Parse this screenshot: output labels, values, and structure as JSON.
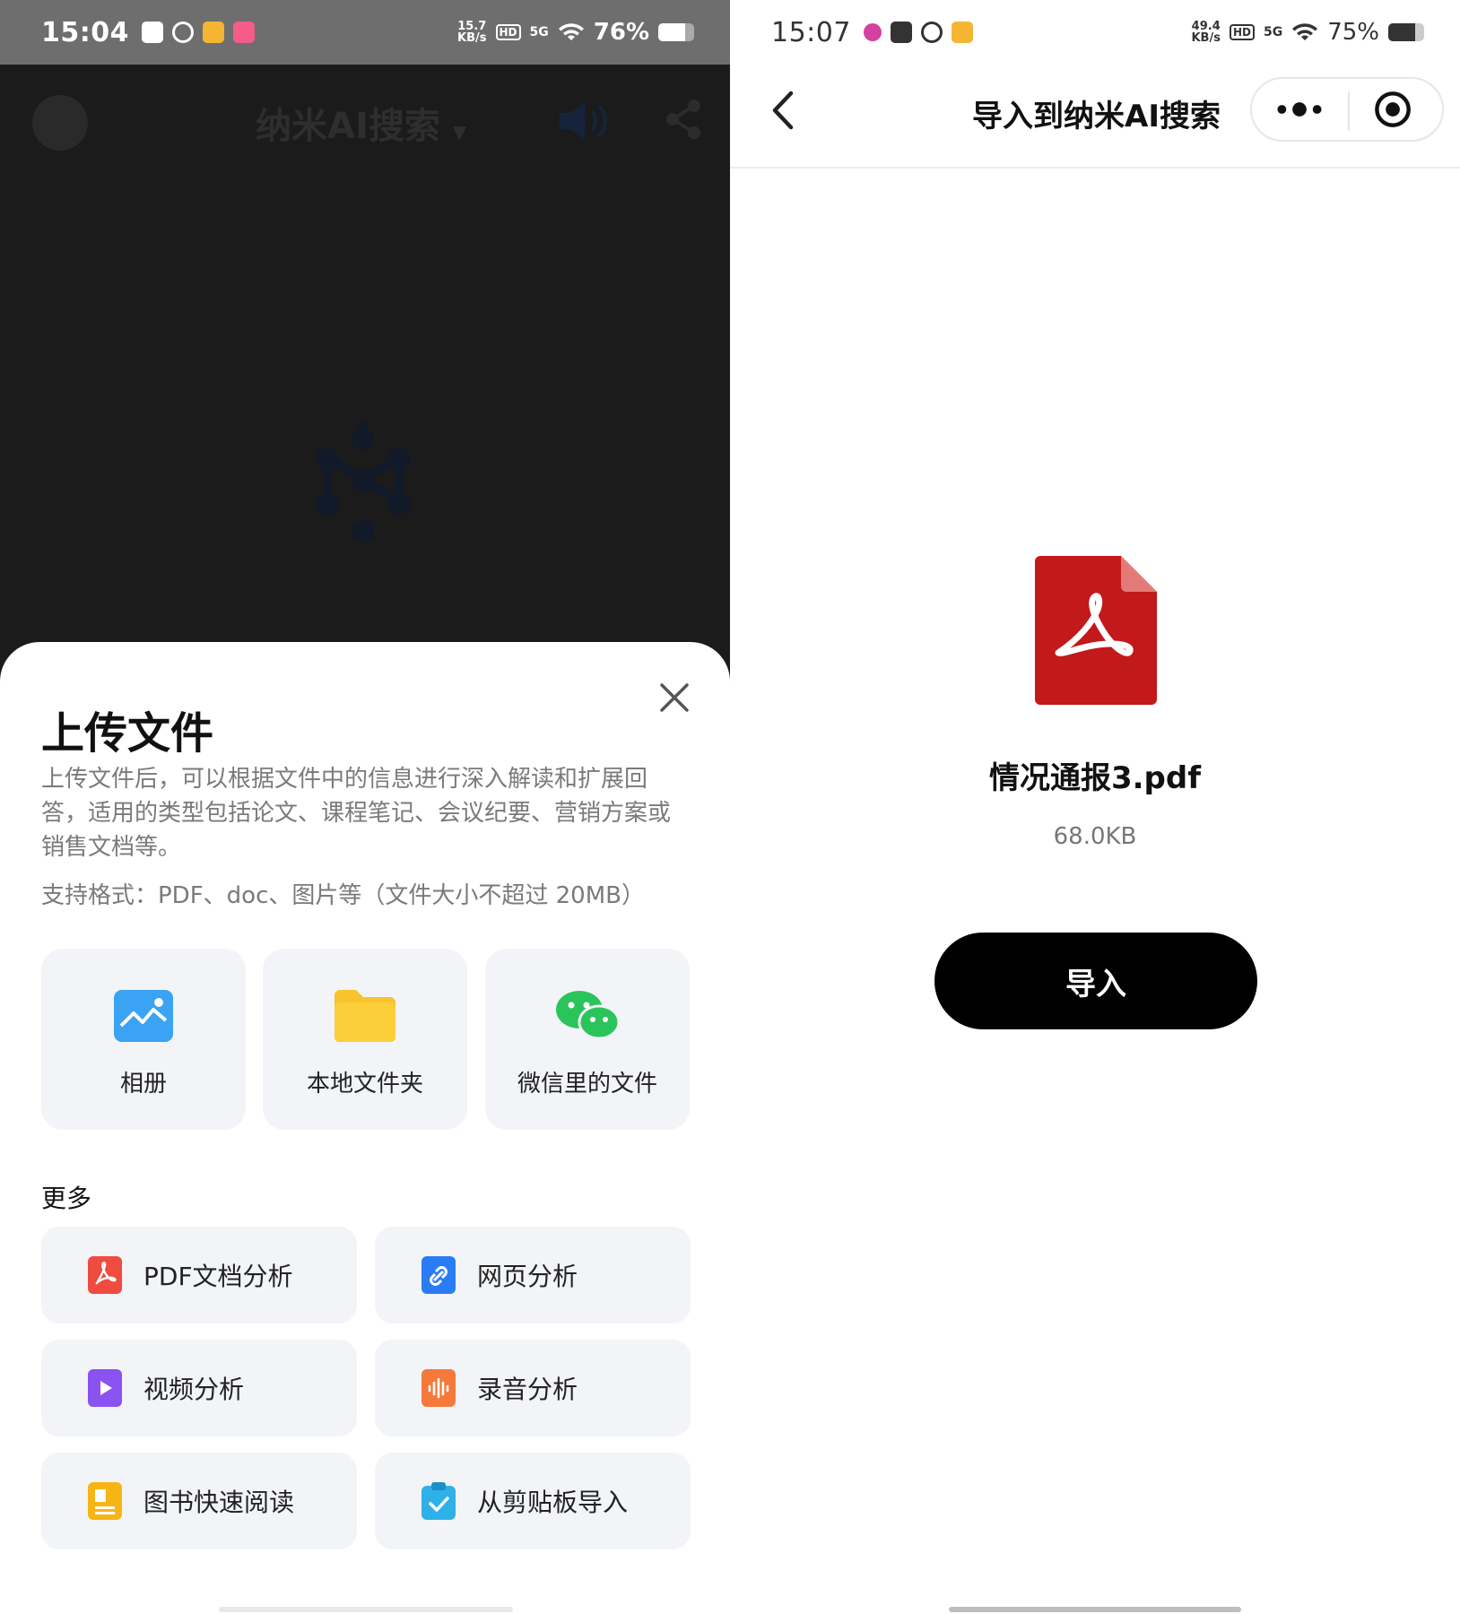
{
  "left": {
    "status": {
      "time": "15:04",
      "speed_top": "15.7",
      "speed_bottom": "KB/s",
      "hd": "HD",
      "net": "5G",
      "battery": "76%",
      "battery_level": 0.76
    },
    "header": {
      "app_title": "纳米AI搜索"
    },
    "sheet": {
      "title": "上传文件",
      "description": "上传文件后，可以根据文件中的信息进行深入解读和扩展回答，适用的类型包括论文、课程笔记、会议纪要、营销方案或销售文档等。",
      "formats": "支持格式：PDF、doc、图片等（文件大小不超过 20MB）",
      "sources": [
        {
          "label": "相册",
          "icon": "gallery-icon"
        },
        {
          "label": "本地文件夹",
          "icon": "folder-icon"
        },
        {
          "label": "微信里的文件",
          "icon": "wechat-icon"
        }
      ],
      "more_title": "更多",
      "more_items": [
        {
          "label": "PDF文档分析",
          "icon": "pdf-icon"
        },
        {
          "label": "网页分析",
          "icon": "link-icon"
        },
        {
          "label": "视频分析",
          "icon": "video-icon"
        },
        {
          "label": "录音分析",
          "icon": "audio-icon"
        },
        {
          "label": "图书快速阅读",
          "icon": "book-icon"
        },
        {
          "label": "从剪贴板导入",
          "icon": "clipboard-icon"
        }
      ]
    }
  },
  "right": {
    "status": {
      "time": "15:07",
      "speed_top": "49.4",
      "speed_bottom": "KB/s",
      "hd": "HD",
      "net": "5G",
      "battery": "75%",
      "battery_level": 0.75
    },
    "nav": {
      "title": "导入到纳米AI搜索"
    },
    "file": {
      "name": "情况通报3.pdf",
      "size": "68.0KB"
    },
    "import_button": "导入"
  },
  "colors": {
    "pdf_red": "#c2191b",
    "button_black": "#000000",
    "tile_bg": "#f2f4f7"
  }
}
